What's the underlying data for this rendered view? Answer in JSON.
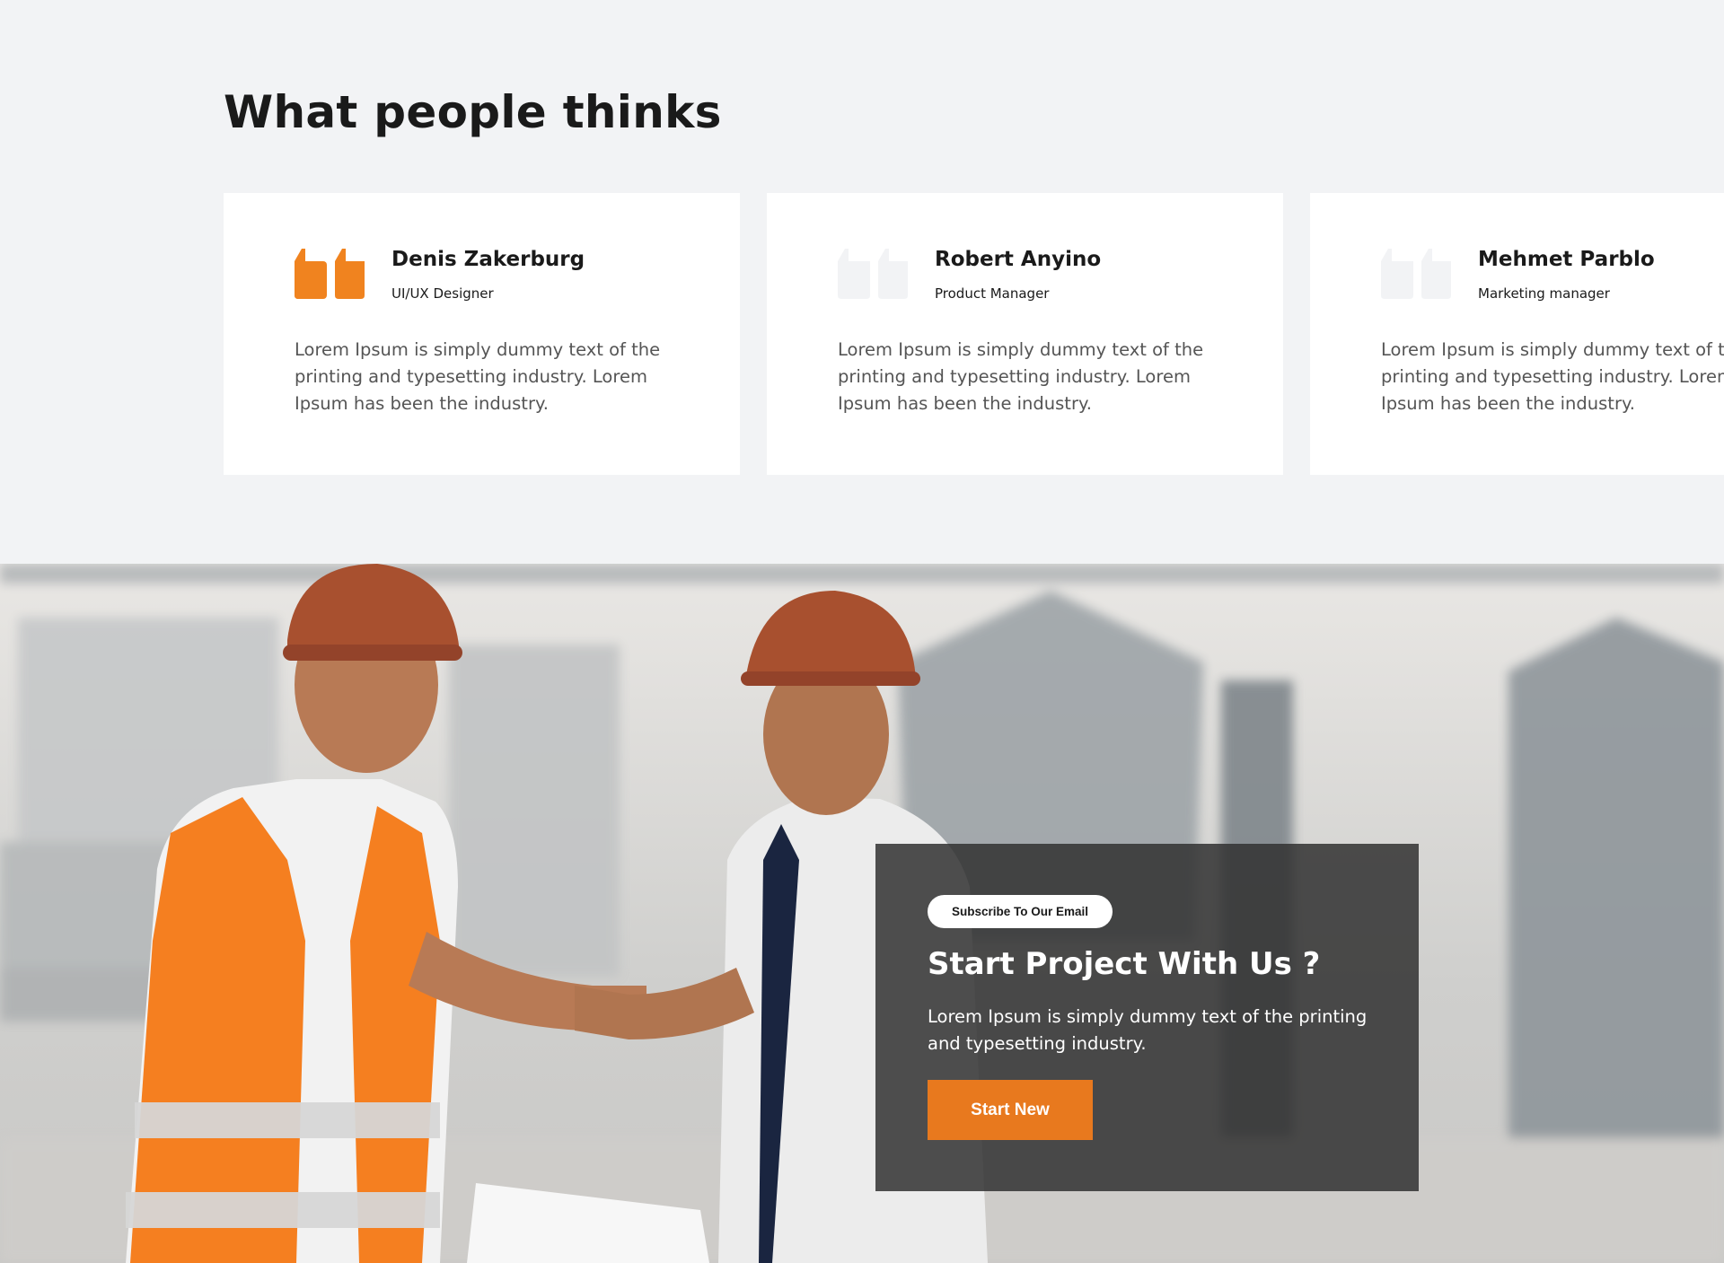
{
  "testimonials": {
    "title": "What people thinks",
    "cards": [
      {
        "name": "Denis Zakerburg",
        "role": "UI/UX Designer",
        "text": "Lorem Ipsum is simply dummy text of the printing and typesetting industry. Lorem Ipsum has been the industry.",
        "quote_icon": "quote-icon",
        "quote_color": "#f0831f"
      },
      {
        "name": "Robert Anyino",
        "role": "Product Manager",
        "text": "Lorem Ipsum is simply dummy text of the printing and typesetting industry. Lorem Ipsum has been the industry.",
        "quote_icon": "quote-icon",
        "quote_color": "#f2f3f5"
      },
      {
        "name": "Mehmet Parblo",
        "role": "Marketing manager",
        "text": "Lorem Ipsum is simply dummy text of the printing and typesetting industry. Lorem Ipsum has been the industry.",
        "quote_icon": "quote-icon",
        "quote_color": "#f2f3f5"
      }
    ]
  },
  "cta": {
    "badge": "Subscribe To Our Email",
    "heading": "Start Project With Us ?",
    "description": "Lorem Ipsum is simply dummy text of the printing and typesetting industry.",
    "button_label": "Start New",
    "accent_color": "#e8791e"
  }
}
